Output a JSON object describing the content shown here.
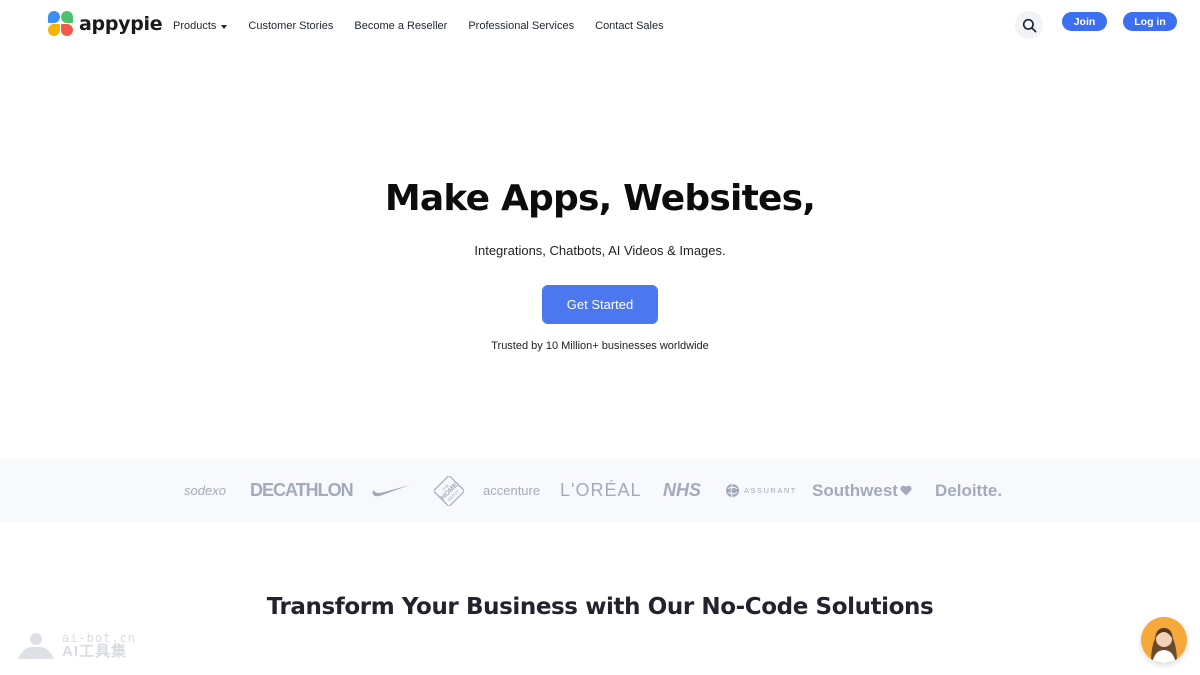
{
  "nav": {
    "logo_text": "appypie",
    "items": [
      {
        "label": "Products",
        "has_dropdown": true
      },
      {
        "label": "Customer Stories"
      },
      {
        "label": "Become a Reseller"
      },
      {
        "label": "Professional Services"
      },
      {
        "label": "Contact Sales"
      }
    ],
    "search_icon": "search-icon",
    "join_label": "Join",
    "login_label": "Log in"
  },
  "hero": {
    "title": "Make Apps, Websites,",
    "subtitle": "Integrations, Chatbots, AI Videos & Images.",
    "cta_label": "Get Started",
    "trusted_text": "Trusted by 10 Million+ businesses worldwide"
  },
  "clients": {
    "logos": [
      "sodexo",
      "DECATHLON",
      "nike-swoosh",
      "THE HOME DEPOT",
      "accenture",
      "L'ORÉAL",
      "NHS",
      "ASSURANT",
      "Southwest",
      "Deloitte."
    ]
  },
  "section": {
    "title": "Transform Your Business with Our No-Code Solutions"
  },
  "watermark": {
    "domain": "ai-bot.cn",
    "name": "AI工具集"
  },
  "colors": {
    "primary": "#3d6ff2",
    "cta": "#4b78ef",
    "logo_gray": "#a3abba",
    "strip_bg": "#f8f9fc"
  }
}
